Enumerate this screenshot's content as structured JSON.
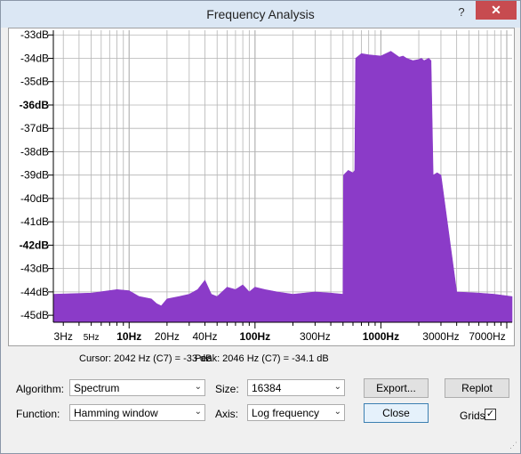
{
  "window": {
    "title": "Frequency Analysis",
    "help_glyph": "?",
    "close_glyph": "✕"
  },
  "colors": {
    "spectrum_fill": "#8b3bc8",
    "grid": "#b4b4b4",
    "titlebar": "#dbe7f4",
    "close_button": "#c74b50"
  },
  "chart_data": {
    "type": "area",
    "xscale": "log",
    "xlim": [
      2.5,
      11025
    ],
    "ylim": [
      -45.3,
      -32.8
    ],
    "grid": true,
    "yticks": [
      "-33dB",
      "-34dB",
      "-35dB",
      "-36dB",
      "-37dB",
      "-38dB",
      "-39dB",
      "-40dB",
      "-41dB",
      "-42dB",
      "-43dB",
      "-44dB",
      "-45dB"
    ],
    "ytick_values": [
      -33,
      -34,
      -35,
      -36,
      -37,
      -38,
      -39,
      -40,
      -41,
      -42,
      -43,
      -44,
      -45
    ],
    "ytick_bold": [
      false,
      false,
      false,
      true,
      false,
      false,
      false,
      false,
      false,
      true,
      false,
      false,
      false
    ],
    "xticks": [
      {
        "label": "3Hz",
        "value": 3,
        "bold": false,
        "small": false
      },
      {
        "label": "5Hz",
        "value": 5,
        "bold": false,
        "small": true
      },
      {
        "label": "10Hz",
        "value": 10,
        "bold": true,
        "small": false
      },
      {
        "label": "20Hz",
        "value": 20,
        "bold": false,
        "small": false
      },
      {
        "label": "40Hz",
        "value": 40,
        "bold": false,
        "small": false
      },
      {
        "label": "100Hz",
        "value": 100,
        "bold": true,
        "small": false
      },
      {
        "label": "300Hz",
        "value": 300,
        "bold": false,
        "small": false
      },
      {
        "label": "1000Hz",
        "value": 1000,
        "bold": true,
        "small": false
      },
      {
        "label": "3000Hz",
        "value": 3000,
        "bold": false,
        "small": false
      },
      {
        "label": "7000Hz",
        "value": 7000,
        "bold": false,
        "small": false
      }
    ],
    "series": [
      {
        "x": [
          2.5,
          5,
          8,
          10,
          12,
          15,
          16.5,
          18,
          20,
          25,
          30,
          35,
          40,
          45,
          50,
          60,
          70,
          80,
          90,
          100,
          120,
          150,
          200,
          300,
          400,
          500,
          505,
          550,
          600,
          620,
          630,
          700,
          800,
          1000,
          1200,
          1400,
          1500,
          1600,
          1800,
          2000,
          2100,
          2200,
          2400,
          2500,
          2600,
          2800,
          3000,
          4000,
          6000,
          8000,
          11025
        ],
        "y": [
          -44.1,
          -44.05,
          -43.9,
          -43.95,
          -44.2,
          -44.3,
          -44.5,
          -44.6,
          -44.3,
          -44.2,
          -44.1,
          -43.9,
          -43.5,
          -44.1,
          -44.2,
          -43.8,
          -43.9,
          -43.7,
          -44.0,
          -43.8,
          -43.9,
          -44.0,
          -44.1,
          -44.0,
          -44.05,
          -44.1,
          -39.0,
          -38.8,
          -38.9,
          -38.8,
          -34.0,
          -33.8,
          -33.85,
          -33.9,
          -33.7,
          -33.95,
          -33.9,
          -34.0,
          -34.1,
          -34.05,
          -34.0,
          -34.1,
          -34.0,
          -34.1,
          -39.0,
          -38.9,
          -39.0,
          -44.0,
          -44.05,
          -44.1,
          -44.2
        ]
      }
    ]
  },
  "readout": {
    "cursor": "Cursor: 2042 Hz (C7) = -33 dB",
    "peak": "Peak: 2046 Hz (C7) = -34.1 dB"
  },
  "controls": {
    "algorithm_label": "Algorithm:",
    "algorithm_value": "Spectrum",
    "function_label": "Function:",
    "function_value": "Hamming window",
    "size_label": "Size:",
    "size_value": "16384",
    "axis_label": "Axis:",
    "axis_value": "Log frequency",
    "export_label": "Export...",
    "replot_label": "Replot",
    "close_label": "Close",
    "grids_label": "Grids",
    "grids_checked": true,
    "dropdown_arrow": "⌄",
    "check_glyph": "✓"
  }
}
